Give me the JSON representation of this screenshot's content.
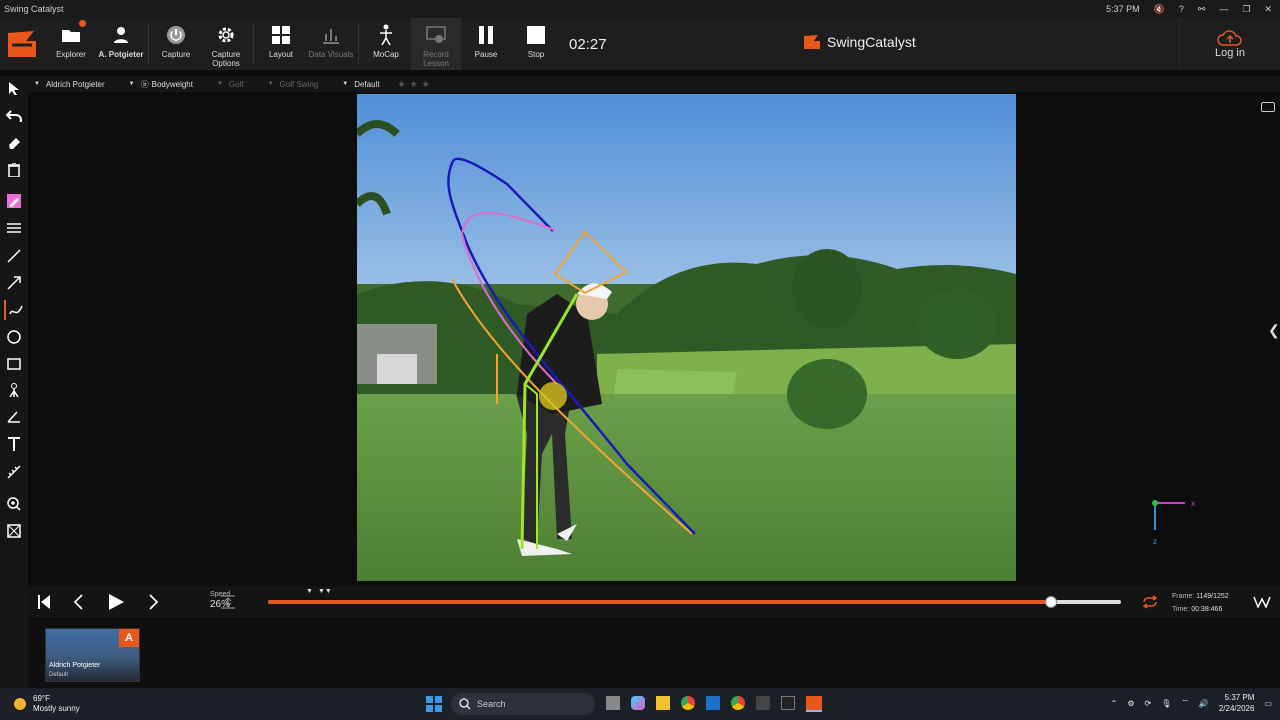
{
  "window": {
    "title": "Swing Catalyst",
    "time": "5:37 PM"
  },
  "toolbar": {
    "explorer": "Explorer",
    "athlete": "A. Potgieter",
    "capture": "Capture",
    "capture_options": "Capture Options",
    "layout": "Layout",
    "data_visuals": "Data Visuals",
    "mocap": "MoCap",
    "record_lesson": "Record Lesson",
    "pause": "Pause",
    "stop": "Stop",
    "timer": "02:27",
    "brand": "SwingCatalyst",
    "login": "Log in"
  },
  "subbar": {
    "athlete": "Aldrich Potgieter",
    "bodyweight": "Bodyweight",
    "sport": "Golf",
    "activity": "Golf Swing",
    "profile": "Default"
  },
  "player": {
    "speed_label": "Speed",
    "speed_value": "26%",
    "progress": 0.9185,
    "frame_label": "Frame:",
    "frame_value": "1149/1252",
    "time_label": "Time:",
    "time_value": "00:38:466"
  },
  "thumbnail": {
    "badge": "A",
    "name": "Aldrich Potgieter",
    "profile": "Default"
  },
  "taskbar": {
    "temp": "69°F",
    "weather": "Mostly sunny",
    "search_placeholder": "Search",
    "clock_time": "5:37 PM",
    "clock_date": "2/24/2026"
  },
  "axes": {
    "x": "x",
    "z": "z"
  },
  "colors": {
    "accent": "#e8581c"
  }
}
